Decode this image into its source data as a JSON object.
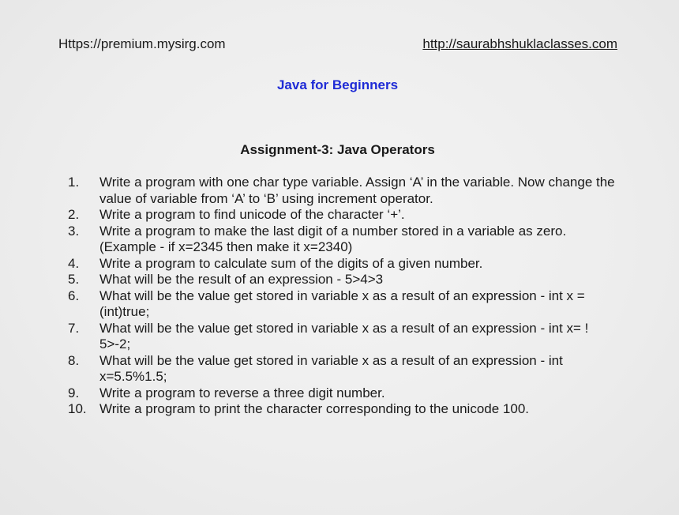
{
  "header": {
    "left_url": "Https://premium.mysirg.com",
    "right_url": "http://saurabhshuklaclasses.com"
  },
  "course_title": "Java for Beginners",
  "assignment_title": "Assignment-3: Java Operators",
  "colors": {
    "course_title": "#1f2bd6",
    "text": "#1a1a1a",
    "background": "#ececec"
  },
  "questions": [
    {
      "num": "1.",
      "text": "Write a program with one char type variable. Assign ‘A’ in the variable. Now change the value of variable from ‘A’ to ‘B’ using increment operator."
    },
    {
      "num": "2.",
      "text": "Write a program to find unicode of the character ‘+’."
    },
    {
      "num": "3.",
      "text": "Write a program to make the last digit of a number stored in a variable as zero. (Example - if x=2345 then make it x=2340)"
    },
    {
      "num": "4.",
      "text": "Write a program to calculate sum of the digits of a given number."
    },
    {
      "num": "5.",
      "text": "What will be the result of an expression - 5>4>3"
    },
    {
      "num": "6.",
      "text": "What will be the value get stored in variable x as a result of an expression - int x = (int)true;"
    },
    {
      "num": "7.",
      "text": "What will be the value get stored in variable x as a result of an expression - int x= ! 5>-2;"
    },
    {
      "num": "8.",
      "text": "What will be the value get stored in variable x as a result of an expression - int x=5.5%1.5;"
    },
    {
      "num": "9.",
      "text": "Write a program to reverse a three digit number."
    },
    {
      "num": "10.",
      "text": "Write a program to print the character corresponding to the unicode 100."
    }
  ]
}
